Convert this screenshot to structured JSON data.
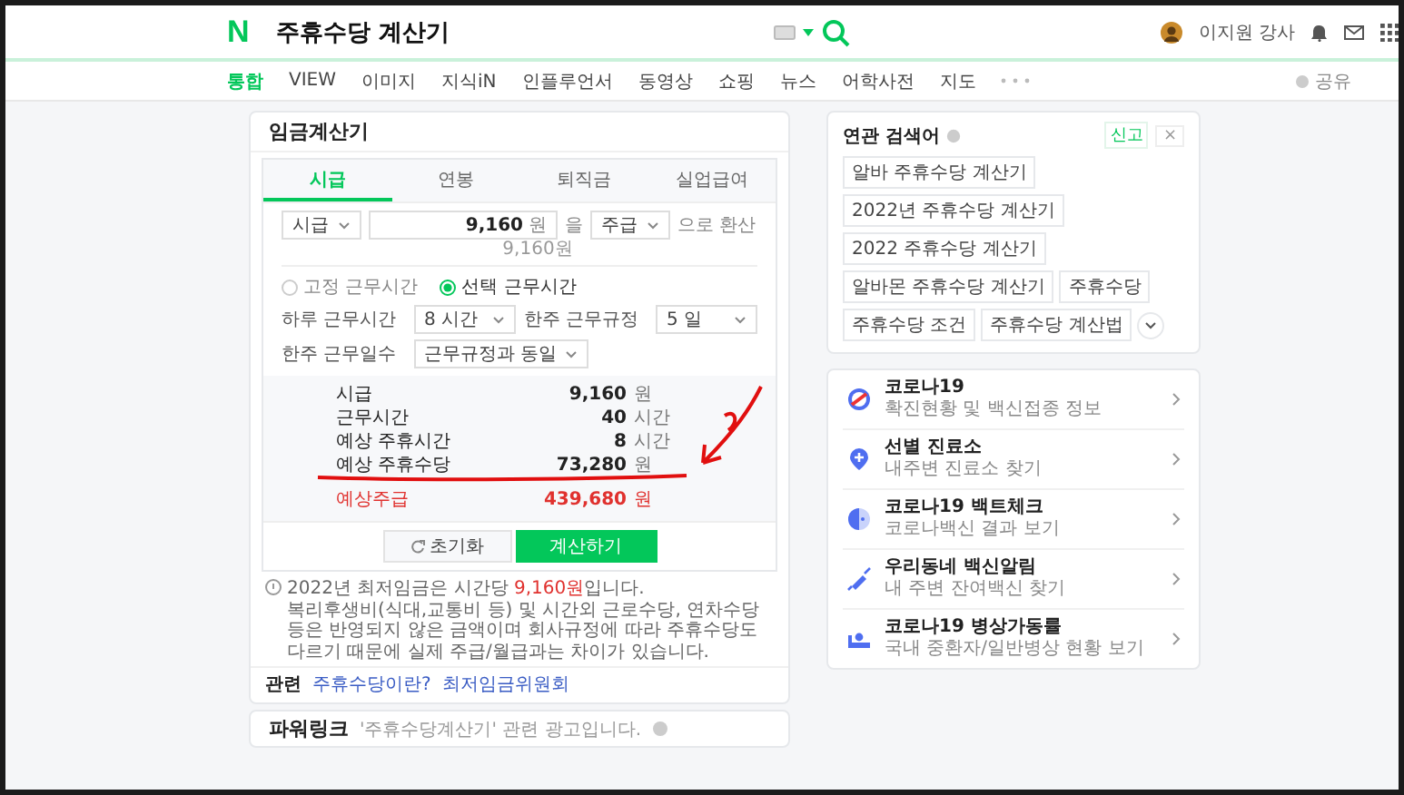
{
  "header": {
    "logo": "N",
    "query": "주휴수당 계산기",
    "user": "이지원 강사"
  },
  "nav": {
    "items": [
      {
        "label": "통합",
        "selected": true
      },
      {
        "label": "VIEW",
        "selected": false
      },
      {
        "label": "이미지",
        "selected": false
      },
      {
        "label": "지식iN",
        "selected": false
      },
      {
        "label": "인플루언서",
        "selected": false
      },
      {
        "label": "동영상",
        "selected": false
      },
      {
        "label": "쇼핑",
        "selected": false
      },
      {
        "label": "뉴스",
        "selected": false
      },
      {
        "label": "어학사전",
        "selected": false
      },
      {
        "label": "지도",
        "selected": false
      }
    ],
    "share": "공유"
  },
  "calculator": {
    "title": "임금계산기",
    "tabs": [
      {
        "label": "시급",
        "selected": true
      },
      {
        "label": "연봉",
        "selected": false
      },
      {
        "label": "퇴직금",
        "selected": false
      },
      {
        "label": "실업급여",
        "selected": false
      }
    ],
    "from_unit": "시급",
    "amount": "9,160",
    "amount_unit": "원",
    "particle": "을",
    "to_unit": "주급",
    "suffix": "으로 환산",
    "amount_hint": "9,160원",
    "modes": [
      {
        "label": "고정 근무시간",
        "selected": false
      },
      {
        "label": "선택 근무시간",
        "selected": true
      }
    ],
    "fields": [
      {
        "label": "하루 근무시간",
        "value": "8 시간"
      },
      {
        "label": "한주 근무규정",
        "value": "5 일"
      },
      {
        "label": "한주 근무일수",
        "value": "근무규정과 동일"
      }
    ],
    "results": [
      {
        "label": "시급",
        "value": "9,160",
        "unit": "원",
        "highlight": false
      },
      {
        "label": "근무시간",
        "value": "40",
        "unit": "시간",
        "highlight": false
      },
      {
        "label": "예상 주휴시간",
        "value": "8",
        "unit": "시간",
        "highlight": false
      },
      {
        "label": "예상 주휴수당",
        "value": "73,280",
        "unit": "원",
        "highlight": false
      },
      {
        "label": "예상주급",
        "value": "439,680",
        "unit": "원",
        "highlight": true
      }
    ],
    "reset": "초기화",
    "calculate": "계산하기",
    "notice": {
      "before": "2022년 최저임금은 시간당 ",
      "highlight": "9,160원",
      "after": "입니다.",
      "detail": "복리후생비(식대,교통비 등) 및 시간외 근로수당, 연차수당 등은 반영되지 않은 금액이며 회사규정에 따라 주휴수당도 다르기 때문에 실제 주급/월급과는 차이가 있습니다."
    },
    "related": {
      "label": "관련",
      "links": [
        "주휴수당이란?",
        "최저임금위원회"
      ]
    }
  },
  "power_link": {
    "title": "파워링크",
    "text": "'주휴수당계산기' 관련 광고입니다."
  },
  "related_searches": {
    "title": "연관 검색어",
    "report": "신고",
    "close": "×",
    "keywords": [
      "알바 주휴수당 계산기",
      "2022년 주휴수당 계산기",
      "2022 주휴수당 계산기",
      "알바몬 주휴수당 계산기",
      "주휴수당",
      "주휴수당 조건",
      "주휴수당 계산법"
    ]
  },
  "services": [
    {
      "kind": "status",
      "title": "코로나19",
      "subtitle": "확진현황 및 백신접종 정보"
    },
    {
      "kind": "clinic",
      "title": "선별 진료소",
      "subtitle": "내주변 진료소 찾기"
    },
    {
      "kind": "test",
      "title": "코로나19 백트체크",
      "subtitle": "코로나백신 결과 보기"
    },
    {
      "kind": "vaccine",
      "title": "우리동네 백신알림",
      "subtitle": "내 주변 잔여백신 찾기"
    },
    {
      "kind": "bed",
      "title": "코로나19 병상가동률",
      "subtitle": "국내 중환자/일반병상 현황 보기"
    }
  ]
}
